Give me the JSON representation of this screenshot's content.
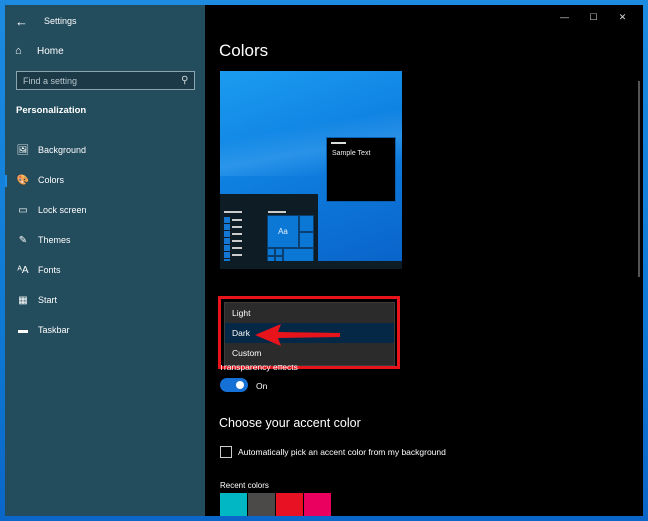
{
  "window": {
    "title": "Settings",
    "controls": {
      "minimize": "—",
      "maximize": "☐",
      "close": "✕"
    }
  },
  "sidebar": {
    "back_icon": "←",
    "home": {
      "icon": "⌂",
      "label": "Home"
    },
    "search": {
      "placeholder": "Find a setting",
      "icon": "⚲"
    },
    "section_title": "Personalization",
    "items": [
      {
        "icon": "🖼",
        "label": "Background",
        "active": false
      },
      {
        "icon": "🎨",
        "label": "Colors",
        "active": true
      },
      {
        "icon": "▭",
        "label": "Lock screen",
        "active": false
      },
      {
        "icon": "✎",
        "label": "Themes",
        "active": false
      },
      {
        "icon": "ᴬA",
        "label": "Fonts",
        "active": false
      },
      {
        "icon": "▦",
        "label": "Start",
        "active": false
      },
      {
        "icon": "▬",
        "label": "Taskbar",
        "active": false
      }
    ],
    "accent_indicator_color": "#1b8ce8"
  },
  "main": {
    "title": "Colors",
    "preview": {
      "sample_text": "Sample Text",
      "tile_label": "Aa"
    },
    "color_mode_dropdown": {
      "options": [
        "Light",
        "Dark",
        "Custom"
      ],
      "selected": "Dark"
    },
    "transparency": {
      "label": "Transparency effects",
      "state_label": "On",
      "enabled": true
    },
    "accent_heading": "Choose your accent color",
    "auto_pick": {
      "label": "Automatically pick an accent color from my background",
      "checked": false
    },
    "recent_colors": {
      "label": "Recent colors",
      "colors": [
        "#00b7c3",
        "#4c4a48",
        "#e81123",
        "#ea005e"
      ]
    }
  },
  "annotation": {
    "highlight_color": "#e8141c"
  }
}
